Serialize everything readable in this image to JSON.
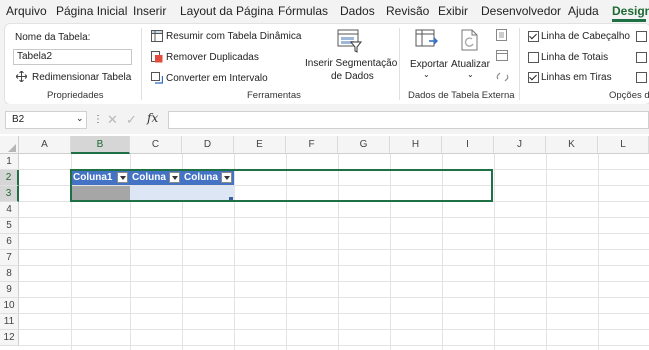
{
  "menu": {
    "tabs": [
      "Arquivo",
      "Página Inicial",
      "Inserir",
      "Layout da Página",
      "Fórmulas",
      "Dados",
      "Revisão",
      "Exibir",
      "Desenvolvedor",
      "Ajuda",
      "Design"
    ],
    "active_tab": "Design"
  },
  "ribbon": {
    "propriedades": {
      "name_label": "Nome da Tabela:",
      "name_value": "Tabela2",
      "resize": "Redimensionar Tabela",
      "group": "Propriedades"
    },
    "ferramentas": {
      "pivot": "Resumir com Tabela Dinâmica",
      "remove_dup": "Remover Duplicadas",
      "convert": "Converter em Intervalo",
      "slicer_line1": "Inserir Segmentação",
      "slicer_line2": "de Dados",
      "group": "Ferramentas"
    },
    "dados_externos": {
      "export": "Exportar",
      "refresh": "Atualizar",
      "group": "Dados de Tabela Externa"
    },
    "opcoes": {
      "header_row": "Linha de Cabeçalho",
      "total_row": "Linha de Totais",
      "banded_rows": "Linhas em Tiras",
      "group": "Opções d"
    }
  },
  "formula_bar": {
    "name_box": "B2",
    "fx": "fx",
    "formula": ""
  },
  "sheet": {
    "columns": [
      "A",
      "B",
      "C",
      "D",
      "E",
      "F",
      "G",
      "H",
      "I",
      "J",
      "K",
      "L"
    ],
    "rows": [
      "1",
      "2",
      "3",
      "4",
      "5",
      "6",
      "7",
      "8",
      "9",
      "10",
      "11",
      "12"
    ],
    "selected_column": "B",
    "selected_rows": [
      "2",
      "3"
    ],
    "table_headers": [
      "Coluna1",
      "Coluna",
      "Coluna"
    ]
  },
  "colors": {
    "accent": "#1e7145",
    "table_header": "#4472c4",
    "table_row": "#dce6f4"
  }
}
